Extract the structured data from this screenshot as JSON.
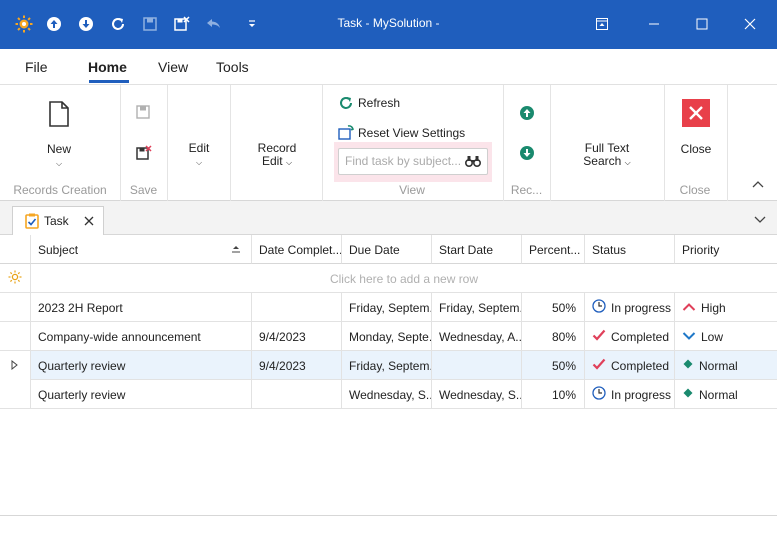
{
  "window": {
    "title": "Task - MySolution -"
  },
  "menu": {
    "tabs": [
      "File",
      "Home",
      "View",
      "Tools"
    ],
    "active": "Home"
  },
  "ribbon": {
    "new_label": "New",
    "records_creation_group": "Records Creation",
    "save_group": "Save",
    "edit_label": "Edit",
    "record_edit_label_1": "Record",
    "record_edit_label_2": "Edit",
    "refresh_label": "Refresh",
    "reset_view_label": "Reset View Settings",
    "search_placeholder": "Find task by subject...",
    "view_group": "View",
    "records_nav_group": "Rec...",
    "full_text_label_1": "Full Text",
    "full_text_label_2": "Search",
    "close_label": "Close",
    "close_group": "Close"
  },
  "doc_tab": {
    "label": "Task"
  },
  "grid": {
    "columns": [
      "Subject",
      "Date Complet...",
      "Due Date",
      "Start Date",
      "Percent...",
      "Status",
      "Priority"
    ],
    "new_row_text": "Click here to add a new row",
    "rows": [
      {
        "subject": "2023 2H Report",
        "date_completed": "",
        "due_date": "Friday, Septem...",
        "start_date": "Friday, Septem...",
        "percent": "50%",
        "status": "In progress",
        "status_icon": "clock-icon",
        "priority": "High",
        "priority_icon": "arrow-up-icon"
      },
      {
        "subject": "Company-wide announcement",
        "date_completed": "9/4/2023",
        "due_date": "Monday, Septe...",
        "start_date": "Wednesday, A...",
        "percent": "80%",
        "status": "Completed",
        "status_icon": "check-icon",
        "priority": "Low",
        "priority_icon": "arrow-down-icon"
      },
      {
        "subject": "Quarterly review",
        "date_completed": "9/4/2023",
        "due_date": "Friday, Septem...",
        "start_date": "",
        "percent": "50%",
        "status": "Completed",
        "status_icon": "check-icon",
        "priority": "Normal",
        "priority_icon": "diamond-icon"
      },
      {
        "subject": "Quarterly review",
        "date_completed": "",
        "due_date": "Wednesday, S...",
        "start_date": "Wednesday, S...",
        "percent": "10%",
        "status": "In progress",
        "status_icon": "clock-icon",
        "priority": "Normal",
        "priority_icon": "diamond-icon"
      }
    ]
  },
  "colors": {
    "titlebar": "#1f5ebd",
    "accent": "#1f5ebd",
    "close_button": "#e8404a",
    "completed_check": "#e0405a",
    "high_arrow": "#e0405a",
    "low_arrow": "#1f78c8",
    "normal_diamond": "#1a8a6e",
    "nav_green": "#1a8a6e"
  }
}
